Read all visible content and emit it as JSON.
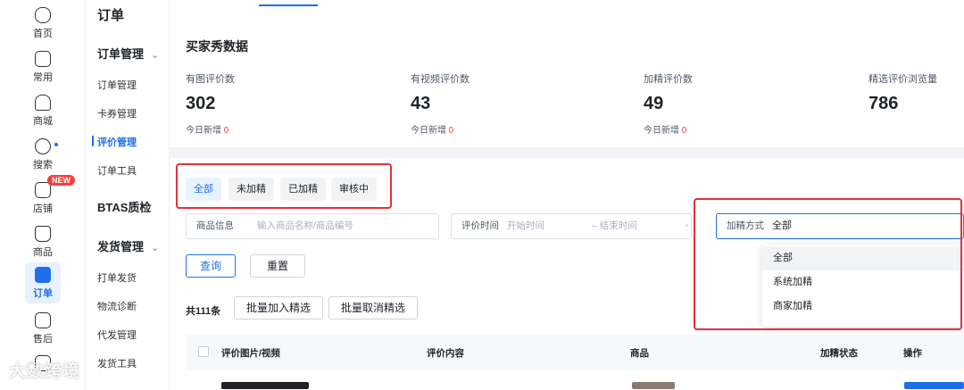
{
  "rail": {
    "items": [
      {
        "label": "首页",
        "icon": "home-icon"
      },
      {
        "label": "常用",
        "icon": "folder-icon"
      },
      {
        "label": "商城",
        "icon": "shop-icon"
      },
      {
        "label": "搜索",
        "icon": "search-icon"
      },
      {
        "label": "店铺",
        "icon": "store-icon",
        "badge": "NEW"
      },
      {
        "label": "商品",
        "icon": "bag-icon"
      },
      {
        "label": "订单",
        "icon": "order-icon"
      },
      {
        "label": "售后",
        "icon": "after-sale-icon"
      }
    ]
  },
  "subnav": {
    "title": "订单",
    "group1": "订单管理",
    "items1": [
      "订单管理",
      "卡券管理",
      "评价管理",
      "订单工具"
    ],
    "group2": "BTAS质检",
    "group3": "发货管理",
    "items3": [
      "打单发货",
      "物流诊断",
      "代发管理",
      "发货工具"
    ]
  },
  "stats": {
    "title": "买家秀数据",
    "items": [
      {
        "label": "有图评价数",
        "value": "302",
        "today_label": "今日新增",
        "today_value": "0"
      },
      {
        "label": "有视频评价数",
        "value": "43",
        "today_label": "今日新增",
        "today_value": "0"
      },
      {
        "label": "加精评价数",
        "value": "49",
        "today_label": "今日新增",
        "today_value": "0"
      },
      {
        "label": "精选评价浏览量",
        "value": "786"
      }
    ]
  },
  "filters": {
    "tabs": [
      "全部",
      "未加精",
      "已加精",
      "审核中"
    ],
    "product_label": "商品信息",
    "product_placeholder": "输入商品名称/商品编号",
    "time_label": "评价时间",
    "time_start": "开始时间",
    "time_end": "– 结束时间",
    "method_label": "加精方式",
    "method_value": "全部",
    "query_button": "查询",
    "reset_button": "重置"
  },
  "list": {
    "count": "共111条",
    "batch_add": "批量加入精选",
    "batch_remove": "批量取消精选",
    "columns": [
      "评价图片/视频",
      "评价内容",
      "商品",
      "加精状态",
      "操作"
    ]
  },
  "dropdown": {
    "options": [
      "全部",
      "系统加精",
      "商家加精"
    ]
  },
  "watermark": "大数跨境",
  "colors": {
    "accent": "#1f6feb",
    "highlight": "#e5303a",
    "today_count": "#f53f3f"
  }
}
